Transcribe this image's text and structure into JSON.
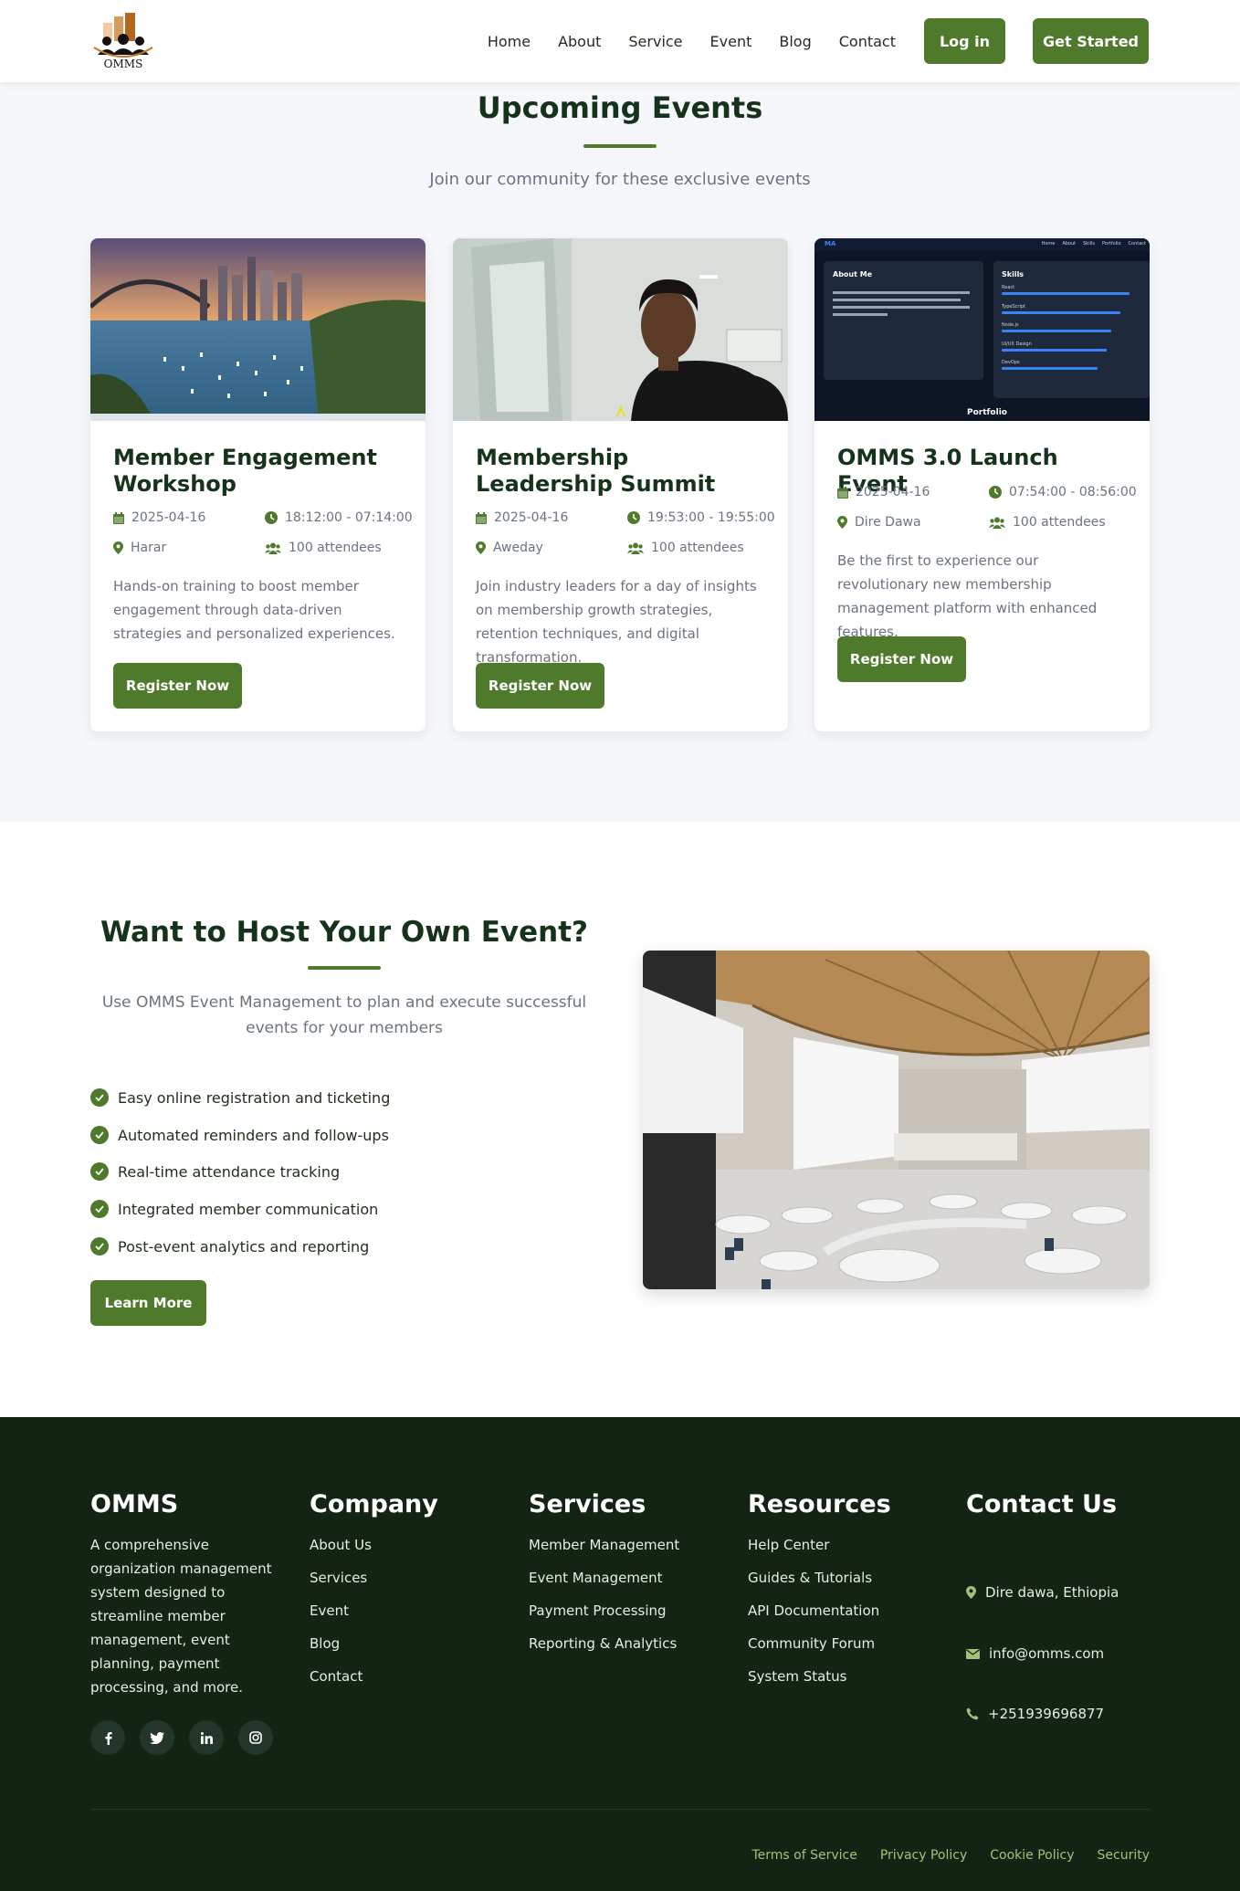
{
  "header": {
    "logo_text": "OMMS",
    "nav": [
      "Home",
      "About",
      "Service",
      "Event",
      "Blog",
      "Contact"
    ],
    "login_label": "Log in",
    "get_started_label": "Get Started"
  },
  "events_section": {
    "title": "Upcoming Events",
    "subtitle": "Join our community for these exclusive events",
    "cards": [
      {
        "title": "Member Engagement Workshop",
        "date": "2025-04-16",
        "time": "18:12:00 - 07:14:00",
        "location": "Harar",
        "attendees": "100 attendees",
        "description": "Hands-on training to boost member engagement through data-driven strategies and personalized experiences.",
        "button": "Register Now"
      },
      {
        "title": "Membership Leadership Summit",
        "date": "2025-04-16",
        "time": "19:53:00 - 19:55:00",
        "location": "Aweday",
        "attendees": "100 attendees",
        "description": "Join industry leaders for a day of insights on membership growth strategies, retention techniques, and digital transformation.",
        "button": "Register Now"
      },
      {
        "title": "OMMS 3.0 Launch Event",
        "date": "2025-04-16",
        "time": "07:54:00 - 08:56:00",
        "location": "Dire Dawa",
        "attendees": "100 attendees",
        "description": "Be the first to experience our revolutionary new membership management platform with enhanced features.",
        "button": "Register Now",
        "screenshot": {
          "brand": "MA",
          "nav": [
            "Home",
            "About",
            "Skills",
            "Portfolio",
            "Contact"
          ],
          "about_title": "About Me",
          "skills_title": "Skills",
          "skills": [
            "React",
            "TypeScript",
            "Node.js",
            "UI/UX Design",
            "DevOps"
          ],
          "caption": "Portfolio"
        }
      }
    ]
  },
  "host_section": {
    "title": "Want to Host Your Own Event?",
    "subtitle": "Use OMMS Event Management to plan and execute successful events for your members",
    "features": [
      "Easy online registration and ticketing",
      "Automated reminders and follow-ups",
      "Real-time attendance tracking",
      "Integrated member communication",
      "Post-event analytics and reporting"
    ],
    "button": "Learn More"
  },
  "footer": {
    "brand": "OMMS",
    "description": "A comprehensive organization management system designed to streamline member management, event planning, payment processing, and more.",
    "social_icons": [
      "facebook-icon",
      "twitter-icon",
      "linkedin-icon",
      "instagram-icon"
    ],
    "company": {
      "title": "Company",
      "links": [
        "About Us",
        "Services",
        "Event",
        "Blog",
        "Contact"
      ]
    },
    "services": {
      "title": "Services",
      "links": [
        "Member Management",
        "Event Management",
        "Payment Processing",
        "Reporting & Analytics"
      ]
    },
    "resources": {
      "title": "Resources",
      "links": [
        "Help Center",
        "Guides & Tutorials",
        "API Documentation",
        "Community Forum",
        "System Status"
      ]
    },
    "contact": {
      "title": "Contact Us",
      "address": "Dire dawa, Ethiopia",
      "email": "info@omms.com",
      "phone": "+251939696877"
    },
    "legal": [
      "Terms of Service",
      "Privacy Policy",
      "Cookie Policy",
      "Security"
    ]
  },
  "colors": {
    "brand_green": "#4f7a2c",
    "dark_green": "#15331a",
    "footer_bg": "#132415",
    "accent_light": "#a3c17a"
  }
}
